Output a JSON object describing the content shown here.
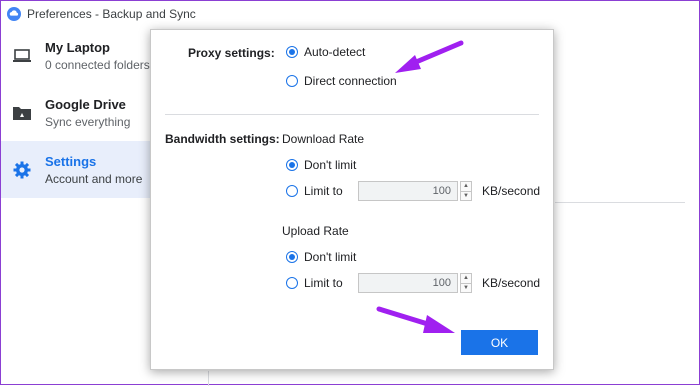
{
  "window": {
    "title": "Preferences - Backup and Sync"
  },
  "sidebar": {
    "items": [
      {
        "title": "My Laptop",
        "subtitle": "0 connected folders",
        "icon": "laptop-icon"
      },
      {
        "title": "Google Drive",
        "subtitle": "Sync everything",
        "icon": "drive-folder-icon"
      },
      {
        "title": "Settings",
        "subtitle": "Account and more",
        "icon": "gear-icon"
      }
    ]
  },
  "dialog": {
    "proxy": {
      "label": "Proxy settings:",
      "options": [
        "Auto-detect",
        "Direct connection"
      ],
      "selected": "Auto-detect"
    },
    "bandwidth": {
      "label": "Bandwidth settings:",
      "download": {
        "heading": "Download Rate",
        "options": [
          "Don't limit",
          "Limit to"
        ],
        "selected": "Don't limit",
        "value": "100",
        "unit": "KB/second"
      },
      "upload": {
        "heading": "Upload Rate",
        "options": [
          "Don't limit",
          "Limit to"
        ],
        "selected": "Don't limit",
        "value": "100",
        "unit": "KB/second"
      }
    },
    "ok_label": "OK"
  },
  "colors": {
    "accent": "#1a73e8",
    "annotation_arrow": "#a020f0",
    "active_bg": "#e8eefb"
  }
}
